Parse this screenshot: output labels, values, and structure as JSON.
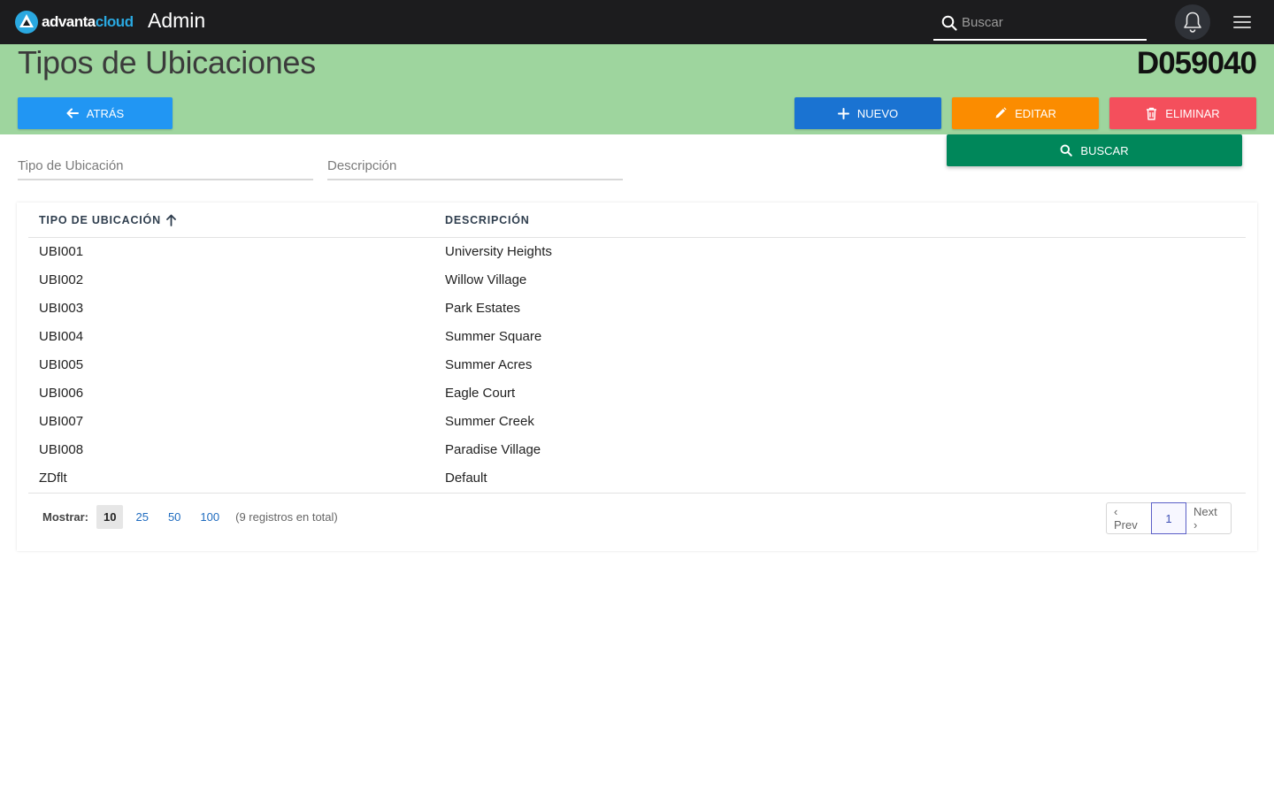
{
  "topbar": {
    "logo_text_a": "advanta",
    "logo_text_b": "cloud",
    "app_title": "Admin",
    "search_placeholder": "Buscar",
    "icons": {
      "search": "search-icon",
      "notifications": "bell-icon",
      "menu": "hamburger-menu-icon"
    }
  },
  "header": {
    "title": "Tipos de Ubicaciones",
    "record_code": "D059040",
    "background_color": "#9ed59e",
    "buttons": {
      "back": "ATRÁS",
      "new": "NUEVO",
      "edit": "EDITAR",
      "delete": "ELIMINAR",
      "search": "BUSCAR"
    },
    "button_colors": {
      "back": "#2196f3",
      "new": "#1a73d2",
      "edit": "#fb8c00",
      "delete": "#f44f5c",
      "search": "#00875a"
    }
  },
  "filters": {
    "tipo_placeholder": "Tipo de Ubicación",
    "desc_placeholder": "Descripción"
  },
  "table": {
    "columns": [
      "TIPO DE UBICACIÓN",
      "DESCRIPCIÓN"
    ],
    "sort": {
      "column": "TIPO DE UBICACIÓN",
      "direction": "ascending"
    },
    "rows": [
      {
        "tipo": "UBI001",
        "desc": "University Heights"
      },
      {
        "tipo": "UBI002",
        "desc": "Willow Village"
      },
      {
        "tipo": "UBI003",
        "desc": "Park Estates"
      },
      {
        "tipo": "UBI004",
        "desc": "Summer Square"
      },
      {
        "tipo": "UBI005",
        "desc": "Summer Acres"
      },
      {
        "tipo": "UBI006",
        "desc": "Eagle Court"
      },
      {
        "tipo": "UBI007",
        "desc": "Summer Creek"
      },
      {
        "tipo": "UBI008",
        "desc": "Paradise Village"
      },
      {
        "tipo": "ZDflt",
        "desc": "Default"
      }
    ]
  },
  "footer": {
    "show_label": "Mostrar:",
    "page_sizes": [
      "10",
      "25",
      "50",
      "100"
    ],
    "selected_page_size": "10",
    "total_text": "(9 registros en total)",
    "pager": {
      "prev": "‹ Prev",
      "current": "1",
      "next": "Next ›"
    }
  }
}
